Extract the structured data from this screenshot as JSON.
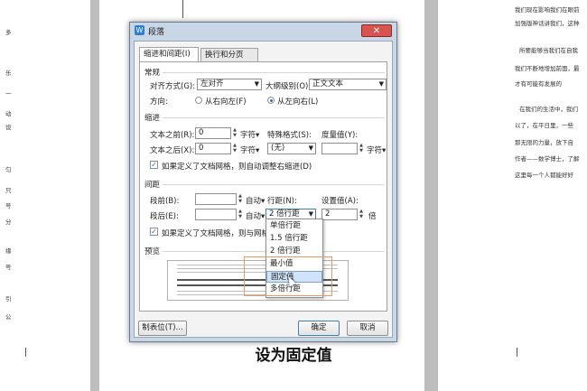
{
  "dialog": {
    "title": "段落",
    "close": "✕",
    "tabs": [
      "缩进和间距(I)",
      "换行和分页(P)"
    ],
    "general": {
      "section": "常规",
      "align_label": "对齐方式(G):",
      "align_value": "左对齐",
      "outline_label": "大纲级别(O):",
      "outline_value": "正文文本",
      "direction_label": "方向:",
      "rtl_label": "从右向左(F)",
      "ltr_label": "从左向右(L)"
    },
    "indent": {
      "section": "缩进",
      "before_label": "文本之前(R):",
      "before_value": "0",
      "before_unit": "字符▾",
      "after_label": "文本之后(X):",
      "after_value": "0",
      "after_unit": "字符▾",
      "special_label": "特殊格式(S):",
      "special_value": "(无)",
      "measure_label": "度量值(Y):",
      "measure_unit": "字符▾",
      "grid_check": "如果定义了文档网格，则自动调整右缩进(D)"
    },
    "spacing": {
      "section": "间距",
      "before_label": "段前(B):",
      "before_unit": "自动▾",
      "after_label": "段后(E):",
      "after_unit": "自动▾",
      "line_label": "行距(N):",
      "line_value": "2 倍行距",
      "setting_label": "设置值(A):",
      "setting_value": "2",
      "setting_unit": "倍",
      "grid_check": "如果定义了文档网格，则与网格对齐(W)"
    },
    "line_options": [
      "单倍行距",
      "1.5 倍行距",
      "2 倍行距",
      "最小值",
      "固定值",
      "多倍行距"
    ],
    "preview_section": "预览",
    "tabs_button": "制表位(T)...",
    "ok_button": "确定",
    "cancel_button": "取消"
  },
  "caption": "设为固定值",
  "left_page_lines": [
    "多",
    "乐",
    "一",
    "动",
    "设",
    "匀",
    "只",
    "号",
    "分",
    "缘",
    "号",
    "引",
    "公"
  ],
  "right_page_lines": [
    "我们现在影响我们在眼前",
    "加强版神话讲我们，这种",
    "所要能够当我们在自我",
    "我们不断地增加前面，最",
    "才有可能有发展的",
    "在我们的生活中，我们",
    "以了，在平日里，一些",
    "那无限的力量，放下自",
    "作者——数学博士，了解",
    "这里每一个人都能好好"
  ],
  "colors": {
    "accent": "#2a6fc9",
    "close": "#d9534f",
    "highlight": "#e39a6a"
  }
}
